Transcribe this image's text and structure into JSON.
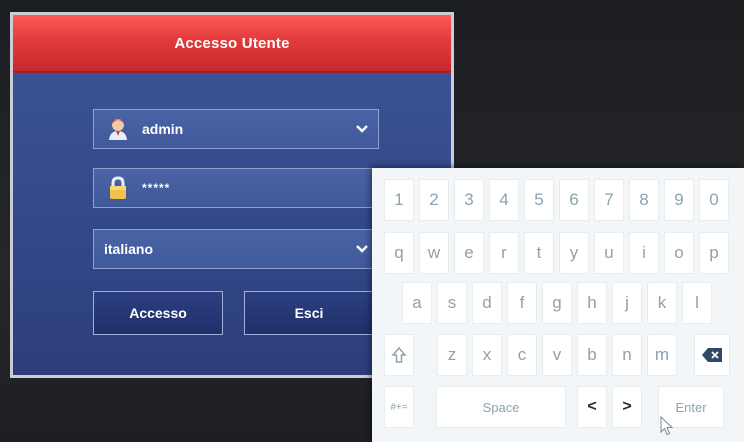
{
  "dialog": {
    "title": "Accesso Utente",
    "username": "admin",
    "password_mask": "*****",
    "language": "italiano",
    "login_label": "Accesso",
    "exit_label": "Esci"
  },
  "keyboard": {
    "row1": [
      "1",
      "2",
      "3",
      "4",
      "5",
      "6",
      "7",
      "8",
      "9",
      "0"
    ],
    "row2": [
      "q",
      "w",
      "e",
      "r",
      "t",
      "y",
      "u",
      "i",
      "o",
      "p"
    ],
    "row3": [
      "a",
      "s",
      "d",
      "f",
      "g",
      "h",
      "j",
      "k",
      "l"
    ],
    "row4": [
      "z",
      "x",
      "c",
      "v",
      "b",
      "n",
      "m"
    ],
    "symbols_label": "#+=",
    "space_label": "Space",
    "left_label": "<",
    "right_label": ">",
    "enter_label": "Enter"
  },
  "icons": {
    "user": "user-avatar-icon",
    "lock": "lock-icon",
    "chevron": "chevron-down-icon",
    "shift": "shift-icon",
    "backspace": "backspace-icon",
    "cursor": "mouse-pointer-icon"
  },
  "colors": {
    "header": "#e33a3b",
    "dialog_bg": "#34498a",
    "keyboard_bg": "#f3f6f8",
    "key_text": "#8fa2ad"
  }
}
